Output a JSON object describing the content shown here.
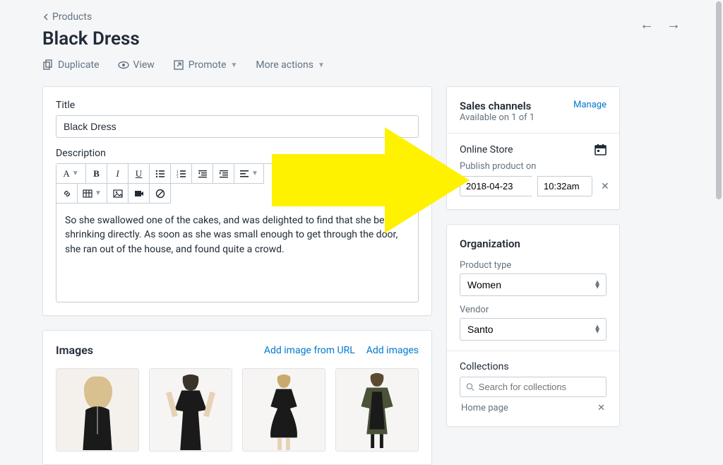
{
  "breadcrumb": {
    "label": "Products"
  },
  "page": {
    "title": "Black Dress"
  },
  "actions": {
    "duplicate": "Duplicate",
    "view": "View",
    "promote": "Promote",
    "more": "More actions"
  },
  "form": {
    "title_label": "Title",
    "title_value": "Black Dress",
    "desc_label": "Description",
    "desc_text": "So she swallowed one of the cakes, and was delighted to find that she began shrinking directly. As soon as she was small enough to get through the door, she ran out of the house, and found quite a crowd."
  },
  "toolbar": {
    "font": "A",
    "bold": "B",
    "italic": "I",
    "underline": "U"
  },
  "images": {
    "heading": "Images",
    "add_url": "Add image from URL",
    "add_images": "Add images"
  },
  "sales": {
    "heading": "Sales channels",
    "subtext": "Available on 1 of 1",
    "manage": "Manage",
    "channel_name": "Online Store",
    "publish_label": "Publish product on",
    "date": "2018-04-23",
    "time": "10:32am"
  },
  "org": {
    "heading": "Organization",
    "type_label": "Product type",
    "type_value": "Women",
    "vendor_label": "Vendor",
    "vendor_value": "Santo",
    "collections_label": "Collections",
    "collections_placeholder": "Search for collections",
    "collection_tag": "Home page"
  }
}
